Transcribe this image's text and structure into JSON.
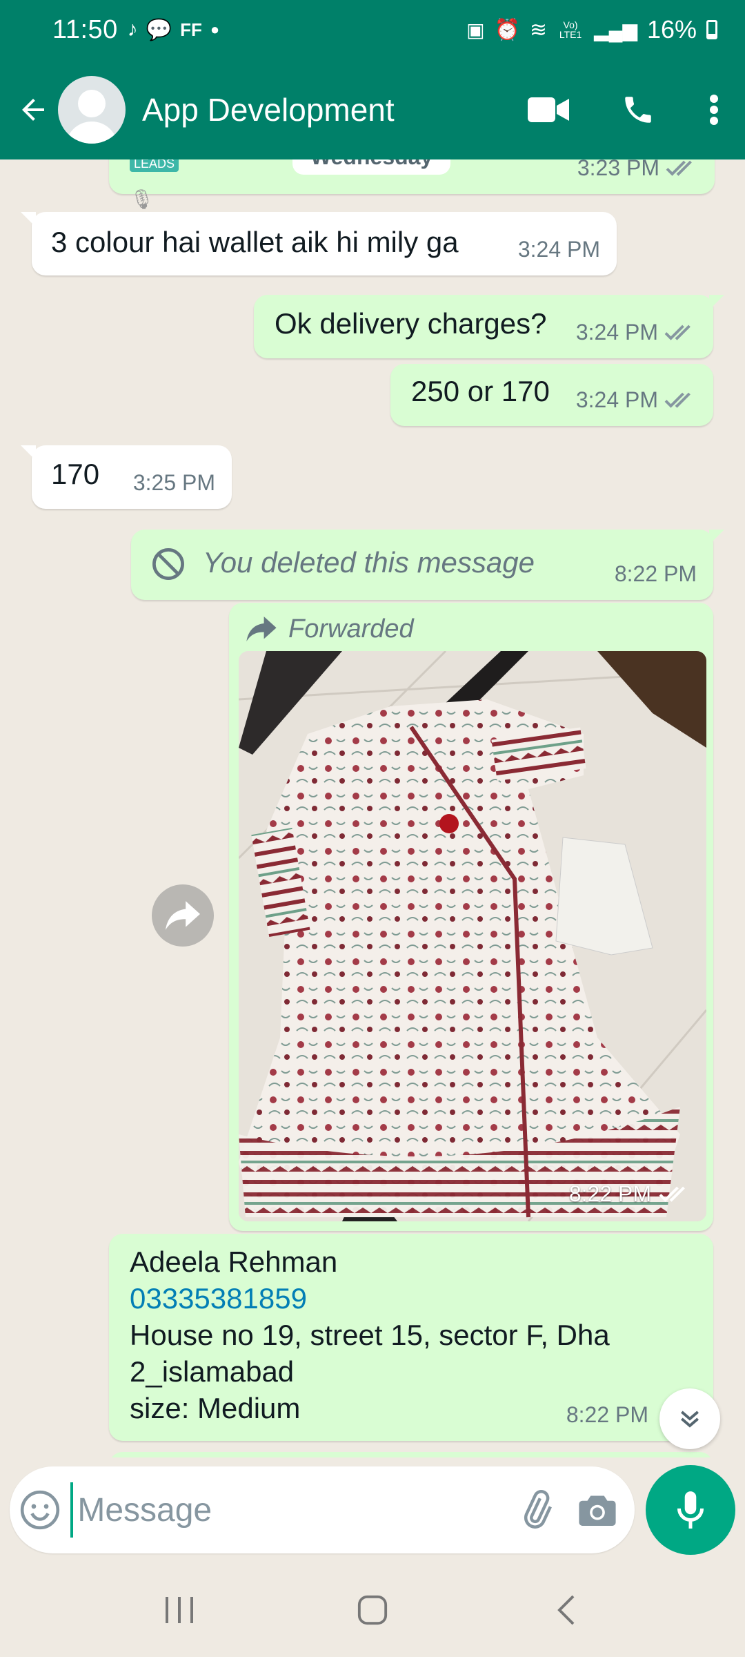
{
  "status_bar": {
    "time": "11:50",
    "ff_label": "FF",
    "battery": "16%",
    "network_label": "Vo) LTE1"
  },
  "header": {
    "title": "App Development",
    "color": "#008069"
  },
  "messages": {
    "top_partial": {
      "time": "3:23 PM",
      "date_chip": "Wednesday",
      "thumb_text": "LEADS"
    },
    "m1": {
      "text": "3 colour hai wallet aik hi mily ga",
      "time": "3:24 PM"
    },
    "m2": {
      "text": "Ok delivery charges?",
      "time": "3:24 PM"
    },
    "m3": {
      "text": "250 or 170",
      "time": "3:24 PM"
    },
    "m4": {
      "text": "170",
      "time": "3:25 PM"
    },
    "m5": {
      "text": "You deleted this message",
      "time": "8:22 PM"
    },
    "m6": {
      "forwarded_label": "Forwarded",
      "time": "8:22 PM"
    },
    "m7": {
      "name": "Adeela Rehman",
      "phone": "03335381859",
      "address_1": "House no 19, street 15, sector F, Dha",
      "address_2": "2_islamabad",
      "size": "size: Medium",
      "time": "8:22 PM"
    }
  },
  "composer": {
    "placeholder": "Message"
  },
  "colors": {
    "accent": "#00a884",
    "outgoing_bubble": "#d9fdd3",
    "incoming_bubble": "#ffffff",
    "read_tick": "#667781"
  }
}
